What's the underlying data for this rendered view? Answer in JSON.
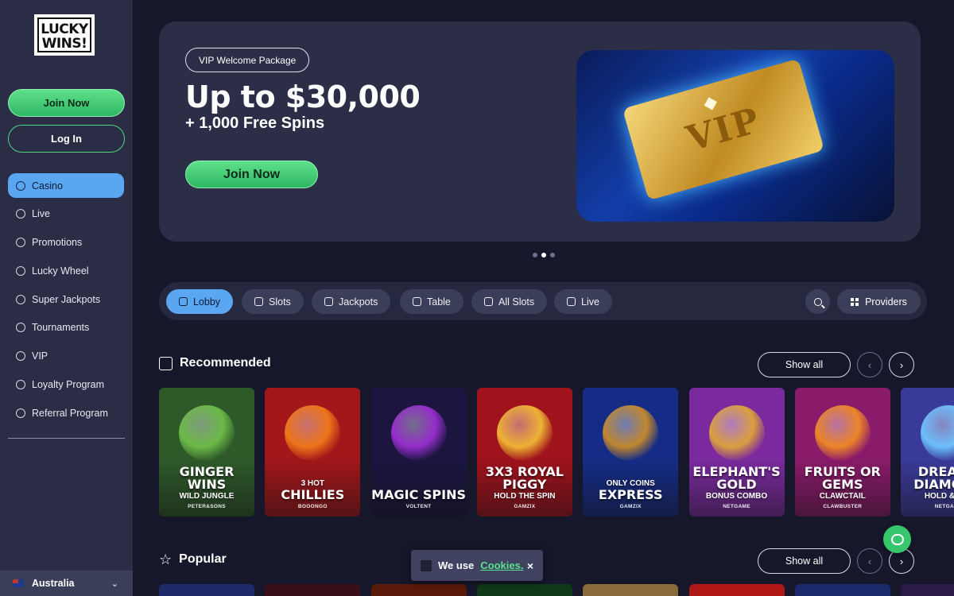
{
  "sidebar": {
    "logo_text": "LUCKY WINS!",
    "join_label": "Join Now",
    "login_label": "Log In",
    "items": [
      {
        "label": "Casino",
        "icon": "casino-icon",
        "active": true
      },
      {
        "label": "Live",
        "icon": "live-icon"
      },
      {
        "label": "Promotions",
        "icon": "gift-icon"
      },
      {
        "label": "Lucky Wheel",
        "icon": "wheel-icon"
      },
      {
        "label": "Super Jackpots",
        "icon": "jackpot-icon"
      },
      {
        "label": "Tournaments",
        "icon": "trophy-icon"
      },
      {
        "label": "VIP",
        "icon": "diamond-icon"
      },
      {
        "label": "Loyalty Program",
        "icon": "loyalty-icon"
      },
      {
        "label": "Referral Program",
        "icon": "referral-icon"
      }
    ],
    "country": "Australia"
  },
  "hero": {
    "pill": "VIP Welcome Package",
    "title": "Up to $30,000",
    "subtitle": "+ 1,000 Free Spins",
    "cta": "Join Now",
    "art_text": "VIP",
    "slide_count": 3,
    "active_slide": 1
  },
  "categories": [
    {
      "label": "Lobby",
      "active": true,
      "icon": "lobby-icon"
    },
    {
      "label": "Slots",
      "icon": "slots-icon"
    },
    {
      "label": "Jackpots",
      "icon": "jackpot-icon"
    },
    {
      "label": "Table",
      "icon": "table-icon"
    },
    {
      "label": "All Slots",
      "icon": "allslots-icon"
    },
    {
      "label": "Live",
      "icon": "live-icon"
    }
  ],
  "providers_label": "Providers",
  "recommended": {
    "title": "Recommended",
    "show_all": "Show all",
    "games": [
      {
        "pre": "",
        "title": "GINGER WINS",
        "sub": "WILD JUNGLE",
        "provider": "PETER&SONS",
        "bg": "#2e5a2a",
        "accent": "#6fbf4a"
      },
      {
        "pre": "3 HOT",
        "title": "CHILLIES",
        "sub": "",
        "provider": "BOOONGO",
        "bg": "#a3161a",
        "accent": "#f07a1a"
      },
      {
        "pre": "",
        "title": "MAGIC SPINS",
        "sub": "",
        "provider": "VOLTENT",
        "bg": "#1b1540",
        "accent": "#9b2fd1"
      },
      {
        "pre": "",
        "title": "3X3 ROYAL PIGGY",
        "sub": "HOLD THE SPIN",
        "provider": "GAMZIX",
        "bg": "#a0121c",
        "accent": "#f2b935"
      },
      {
        "pre": "ONLY COINS",
        "title": "EXPRESS",
        "sub": "",
        "provider": "GAMZIX",
        "bg": "#152c86",
        "accent": "#c98b2a"
      },
      {
        "pre": "",
        "title": "ELEPHANT'S GOLD",
        "sub": "BONUS COMBO",
        "provider": "NETGAME",
        "bg": "#7a2a9e",
        "accent": "#e0a53a"
      },
      {
        "pre": "",
        "title": "FRUITS OR GEMS",
        "sub": "CLAWCTAIL",
        "provider": "CLAWBUSTER",
        "bg": "#8a1a6a",
        "accent": "#f08a24"
      },
      {
        "pre": "",
        "title": "DREAMY DIAMOND",
        "sub": "HOLD & WIN",
        "provider": "NETGAME",
        "bg": "#3a3a9a",
        "accent": "#6ec6ff"
      }
    ]
  },
  "popular": {
    "title": "Popular",
    "show_all": "Show all",
    "tiles": [
      "#1e2a6a",
      "#3a0f18",
      "#5a1a0a",
      "#0f3a1a",
      "#8a6a3a",
      "#b01818",
      "#1a2a6a",
      "#2a1a4a"
    ]
  },
  "cookie": {
    "text": "We use",
    "link": "Cookies.",
    "close": "×"
  }
}
